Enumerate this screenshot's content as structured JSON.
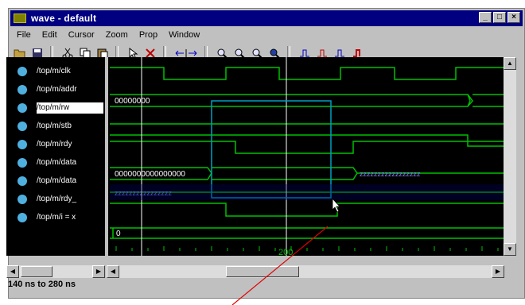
{
  "window": {
    "title": "wave - default"
  },
  "menu": [
    "File",
    "Edit",
    "Cursor",
    "Zoom",
    "Prop",
    "Window"
  ],
  "toolbar_icons": [
    "open-icon",
    "save-icon",
    "cut-icon",
    "copy-icon",
    "paste-icon",
    "select-icon",
    "delete-icon",
    "cursor-arrows-icon",
    "zoom-in-icon",
    "zoom-out-icon",
    "zoom-full-icon",
    "zoom-area-icon",
    "edge-icon",
    "edge-back-icon",
    "edge-forward-icon",
    "stop-icon"
  ],
  "signals": [
    {
      "name": "/top/m/clk",
      "selected": false
    },
    {
      "name": "/top/m/addr",
      "selected": false
    },
    {
      "name": "/top/m/rw",
      "selected": true
    },
    {
      "name": "/top/m/stb",
      "selected": false
    },
    {
      "name": "/top/m/rdy",
      "selected": false
    },
    {
      "name": "/top/m/data",
      "selected": false
    },
    {
      "name": "/top/m/data",
      "selected": false
    },
    {
      "name": "/top/m/rdy_",
      "selected": false
    },
    {
      "name": "/top/m/i = x",
      "selected": false
    }
  ],
  "values": {
    "addr": "00000000",
    "data_a": "0000000000000000",
    "data_a2": "zzzzzzzzzzzzzzzzz",
    "data_b": "zzzzzzzzzzzzzzzz",
    "i": "0"
  },
  "timeline": {
    "label": "200"
  },
  "status": "140 ns to 280 ns",
  "colors": {
    "wave": "#00c000",
    "cursor": "#ffffff",
    "zoom_box": "#00a0c0",
    "timeline": "#00c000",
    "annotation": "#e00000"
  }
}
